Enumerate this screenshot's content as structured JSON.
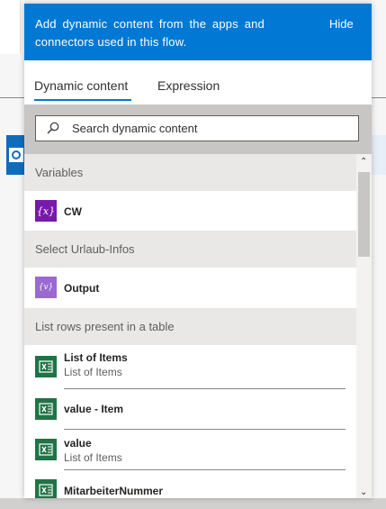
{
  "header": {
    "description": "Add dynamic content from the apps and connectors used in this flow.",
    "hide_label": "Hide"
  },
  "tabs": [
    {
      "label": "Dynamic content",
      "active": true
    },
    {
      "label": "Expression",
      "active": false
    }
  ],
  "search": {
    "placeholder": "Search dynamic content",
    "value": ""
  },
  "sections": [
    {
      "title": "Variables",
      "items": [
        {
          "title": "CW",
          "subtitle": "",
          "icon": "variable-icon"
        }
      ]
    },
    {
      "title": "Select Urlaub-Infos",
      "items": [
        {
          "title": "Output",
          "subtitle": "",
          "icon": "variable-icon"
        }
      ]
    },
    {
      "title": "List rows present in a table",
      "items": [
        {
          "title": "List of Items",
          "subtitle": "List of Items",
          "icon": "excel-icon"
        },
        {
          "title": "value - Item",
          "subtitle": "",
          "icon": "excel-icon"
        },
        {
          "title": "value",
          "subtitle": "List of Items",
          "icon": "excel-icon"
        },
        {
          "title": "MitarbeiterNummer",
          "subtitle": "",
          "icon": "excel-icon"
        }
      ]
    }
  ],
  "colors": {
    "accent": "#0078d4",
    "excel": "#217346",
    "variable": "#7719aa"
  }
}
